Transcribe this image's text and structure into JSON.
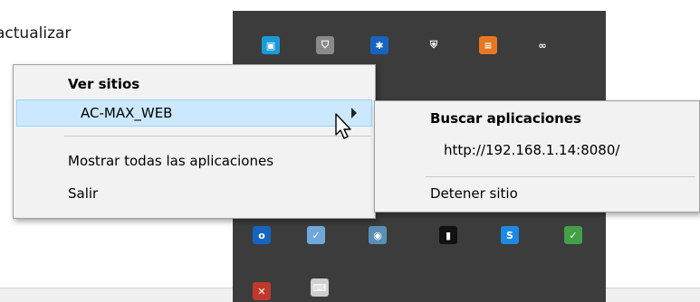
{
  "background_window": {
    "title": "actualizar"
  },
  "tray": {
    "icons": [
      {
        "name": "camera-app-icon",
        "color": "#1a9ad6",
        "glyph": "▣"
      },
      {
        "name": "shield-gray-icon",
        "color": "#8a8a8a",
        "glyph": "⛉"
      },
      {
        "name": "bluetooth-icon",
        "color": "#1565c0",
        "glyph": "✱"
      },
      {
        "name": "defender-shield-icon",
        "color": "#3c3c3c",
        "glyph": "⛨"
      },
      {
        "name": "orange-app-icon",
        "color": "#e87722",
        "glyph": "≡"
      },
      {
        "name": "link-icon",
        "color": "#3c3c3c",
        "glyph": "∞"
      },
      {
        "name": "outlook-icon",
        "color": "#1565c0",
        "glyph": "o"
      },
      {
        "name": "check-mail-icon",
        "color": "#6fa8dc",
        "glyph": "✓"
      },
      {
        "name": "network-globe-icon",
        "color": "#5a8fb5",
        "glyph": "◉"
      },
      {
        "name": "book-icon",
        "color": "#111111",
        "glyph": "▮"
      },
      {
        "name": "skype-icon",
        "color": "#1e88e5",
        "glyph": "S"
      },
      {
        "name": "green-check-icon",
        "color": "#43a047",
        "glyph": "✓"
      },
      {
        "name": "error-app-icon",
        "color": "#c0392b",
        "glyph": "✕"
      },
      {
        "name": "keyboard-icon",
        "color": "#cfcfcf",
        "glyph": "⌨"
      }
    ]
  },
  "main_menu": {
    "header": "Ver sitios",
    "selected_item": "AC-MAX_WEB",
    "items": [
      "Mostrar todas las aplicaciones",
      "Salir"
    ]
  },
  "sub_menu": {
    "header": "Buscar aplicaciones",
    "url": "http://192.168.1.14:8080/",
    "stop": "Detener sitio"
  }
}
